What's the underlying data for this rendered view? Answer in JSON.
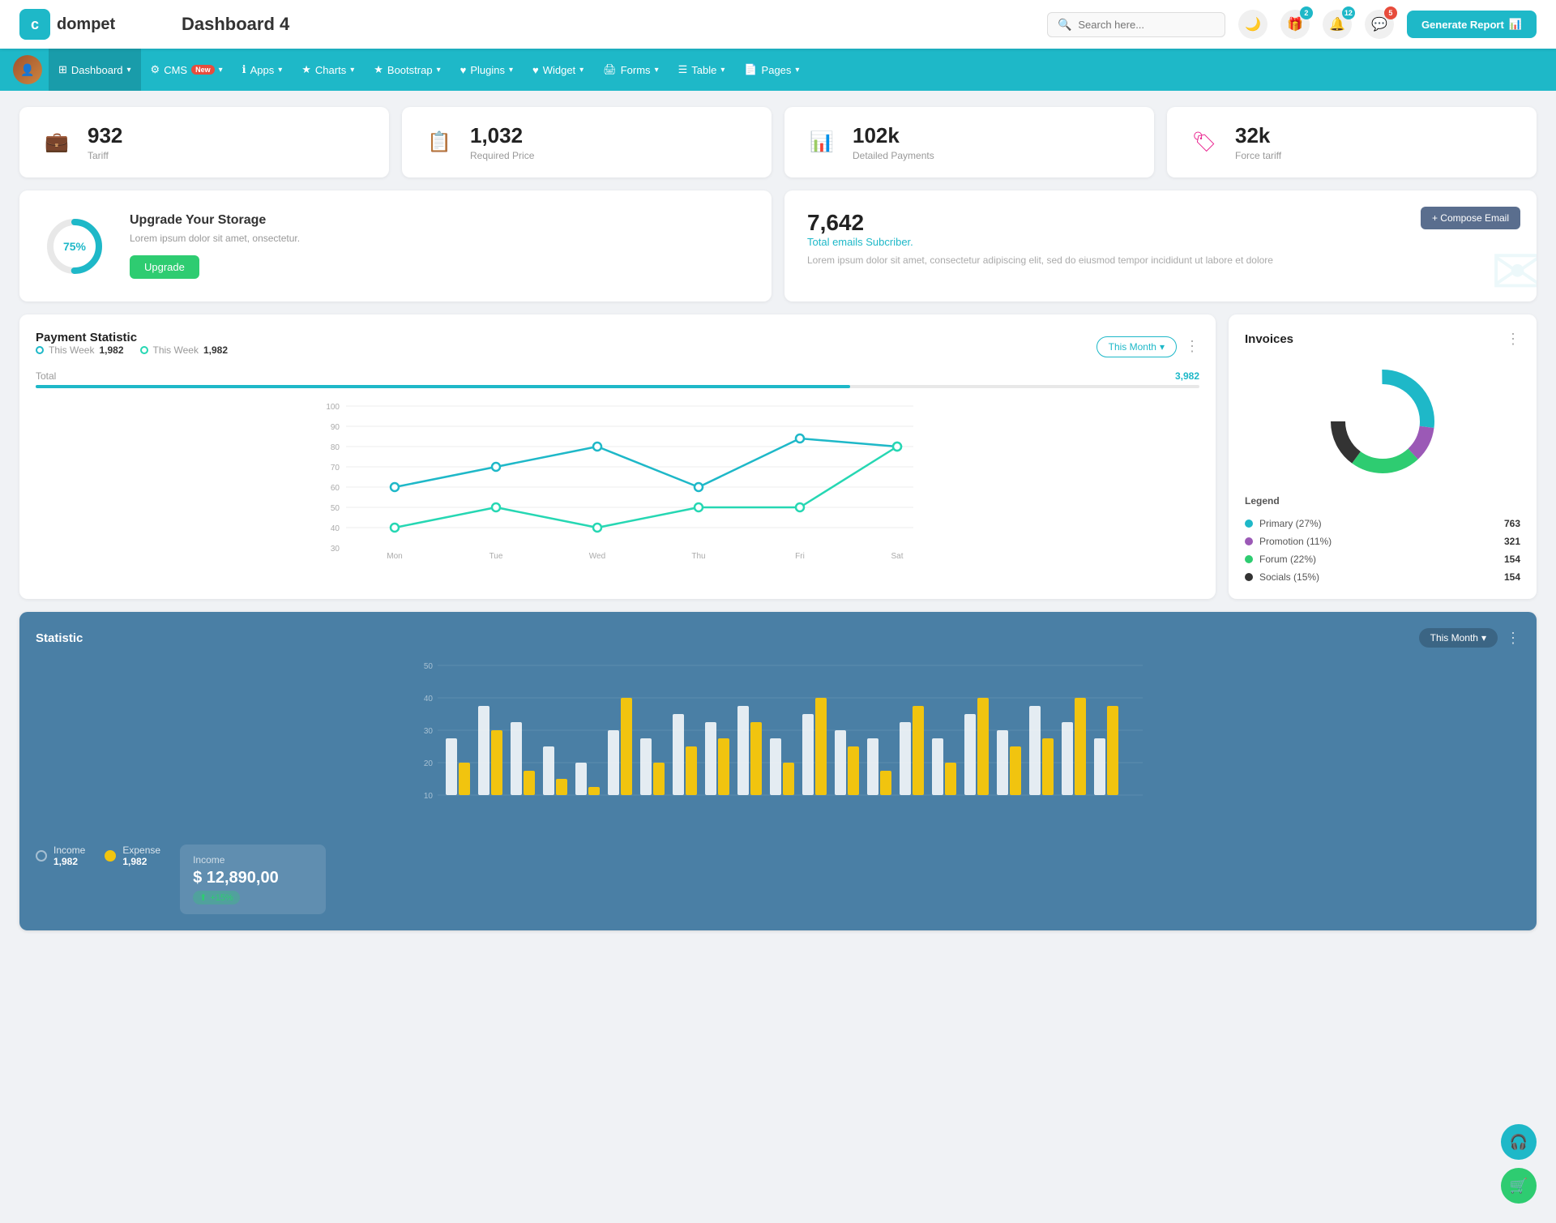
{
  "header": {
    "logo_text": "dompet",
    "page_title": "Dashboard 4",
    "search_placeholder": "Search here...",
    "generate_btn": "Generate Report",
    "icons": {
      "moon": "🌙",
      "gift": "🎁",
      "bell": "🔔",
      "chat": "💬"
    },
    "badges": {
      "gift": "2",
      "bell": "12",
      "chat": "5"
    }
  },
  "navbar": {
    "items": [
      {
        "id": "dashboard",
        "label": "Dashboard",
        "icon": "⊞",
        "active": true,
        "has_dropdown": true
      },
      {
        "id": "cms",
        "label": "CMS",
        "icon": "⚙",
        "has_dropdown": true,
        "badge": "New"
      },
      {
        "id": "apps",
        "label": "Apps",
        "icon": "ℹ",
        "has_dropdown": true
      },
      {
        "id": "charts",
        "label": "Charts",
        "icon": "★",
        "has_dropdown": true
      },
      {
        "id": "bootstrap",
        "label": "Bootstrap",
        "icon": "★",
        "has_dropdown": true
      },
      {
        "id": "plugins",
        "label": "Plugins",
        "icon": "♥",
        "has_dropdown": true
      },
      {
        "id": "widget",
        "label": "Widget",
        "icon": "♥",
        "has_dropdown": true
      },
      {
        "id": "forms",
        "label": "Forms",
        "icon": "🖨",
        "has_dropdown": true
      },
      {
        "id": "table",
        "label": "Table",
        "icon": "☰",
        "has_dropdown": true
      },
      {
        "id": "pages",
        "label": "Pages",
        "icon": "📄",
        "has_dropdown": true
      }
    ]
  },
  "stats": [
    {
      "id": "tariff",
      "value": "932",
      "label": "Tariff",
      "icon": "💼",
      "icon_class": "teal"
    },
    {
      "id": "required-price",
      "value": "1,032",
      "label": "Required Price",
      "icon": "📋",
      "icon_class": "red"
    },
    {
      "id": "detailed-payments",
      "value": "102k",
      "label": "Detailed Payments",
      "icon": "📊",
      "icon_class": "purple"
    },
    {
      "id": "force-tariff",
      "value": "32k",
      "label": "Force tariff",
      "icon": "🏷",
      "icon_class": "pink"
    }
  ],
  "storage": {
    "percent": 75,
    "percent_label": "75%",
    "title": "Upgrade Your Storage",
    "description": "Lorem ipsum dolor sit amet, onsectetur.",
    "btn_label": "Upgrade"
  },
  "email": {
    "count": "7,642",
    "subtitle": "Total emails Subcriber.",
    "description": "Lorem ipsum dolor sit amet, consectetur adipiscing elit, sed do eiusmod tempor incididunt ut labore et dolore",
    "compose_btn": "+ Compose Email"
  },
  "payment": {
    "title": "Payment Statistic",
    "legend": [
      {
        "label": "This Week",
        "value": "1,982"
      },
      {
        "label": "This Week",
        "value": "1,982"
      }
    ],
    "filter": "This Month",
    "total_label": "Total",
    "total_value": "3,982",
    "progress_percent": 70,
    "x_labels": [
      "Mon",
      "Tue",
      "Wed",
      "Thu",
      "Fri",
      "Sat"
    ],
    "y_labels": [
      "100",
      "90",
      "80",
      "70",
      "60",
      "50",
      "40",
      "30"
    ]
  },
  "invoices": {
    "title": "Invoices",
    "legend_title": "Legend",
    "items": [
      {
        "label": "Primary (27%)",
        "color": "#1eb8c8",
        "value": "763"
      },
      {
        "label": "Promotion (11%)",
        "color": "#9b59b6",
        "value": "321"
      },
      {
        "label": "Forum (22%)",
        "color": "#2ecc71",
        "value": "154"
      },
      {
        "label": "Socials (15%)",
        "color": "#333",
        "value": "154"
      }
    ]
  },
  "statistic": {
    "title": "Statistic",
    "filter": "This Month",
    "y_labels": [
      "50",
      "40",
      "30",
      "20",
      "10"
    ],
    "income_label": "Income",
    "income_value": "1,982",
    "expense_label": "Expense",
    "expense_value": "1,982",
    "income_box_title": "Income",
    "income_box_value": "$ 12,890,00",
    "income_badge": "+15%"
  },
  "fab": {
    "support_icon": "🎧",
    "cart_icon": "🛒"
  }
}
